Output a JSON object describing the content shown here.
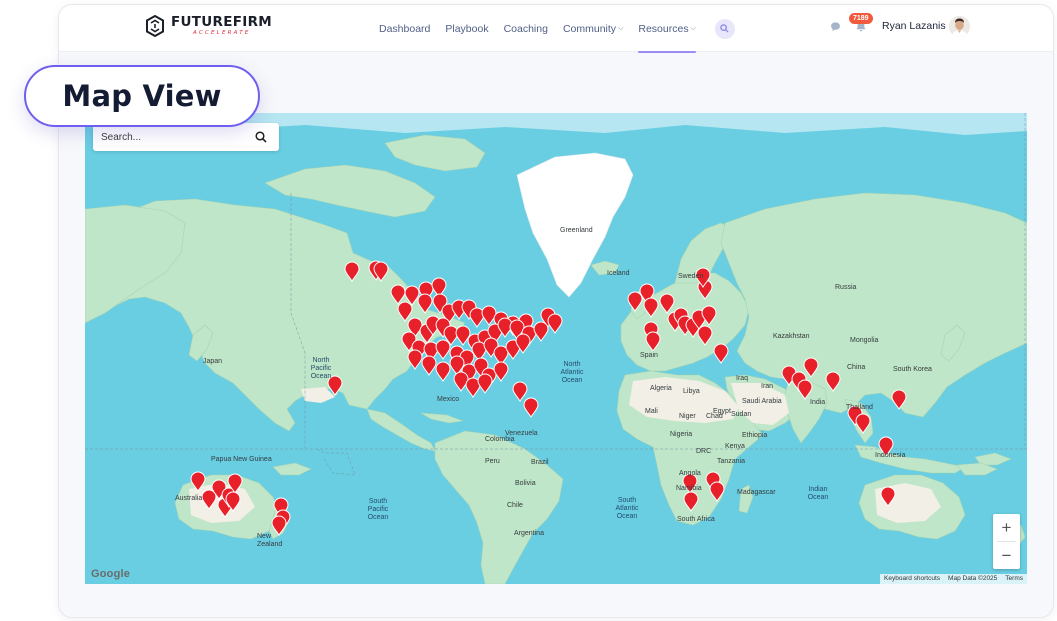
{
  "brand": {
    "name": "FUTUREFIRM",
    "tagline": "ACCELERATE"
  },
  "nav": [
    {
      "label": "Dashboard",
      "dropdown": false,
      "active": false
    },
    {
      "label": "Playbook",
      "dropdown": false,
      "active": false
    },
    {
      "label": "Coaching",
      "dropdown": false,
      "active": false
    },
    {
      "label": "Community",
      "dropdown": true,
      "active": false
    },
    {
      "label": "Resources",
      "dropdown": true,
      "active": true
    }
  ],
  "header": {
    "notification_count": "7189",
    "user_name": "Ryan Lazanis",
    "icons": [
      "search-icon",
      "chat-icon",
      "bell-icon",
      "avatar"
    ]
  },
  "callout": {
    "label": "Map View"
  },
  "map": {
    "search_placeholder": "Search...",
    "labels": {
      "greenland": "Greenland",
      "iceland": "Iceland",
      "sweden": "Sweden",
      "russia": "Russia",
      "kazakhstan": "Kazakhstan",
      "mongolia": "Mongolia",
      "china": "China",
      "south_korea": "South Korea",
      "japan": "Japan",
      "iran": "Iran",
      "iraq": "Iraq",
      "egypt": "Egypt",
      "libya": "Libya",
      "algeria": "Algeria",
      "mali": "Mali",
      "niger": "Niger",
      "chad": "Chad",
      "sudan": "Sudan",
      "nigeria": "Nigeria",
      "ethiopia": "Ethiopia",
      "kenya": "Kenya",
      "drc": "DRC",
      "tanzania": "Tanzania",
      "angola": "Angola",
      "namibia": "Namibia",
      "madagascar": "Madagascar",
      "south_africa": "South Africa",
      "saudi_arabia": "Saudi Arabia",
      "thailand": "Thailand",
      "india": "India",
      "indonesia": "Indonesia",
      "mexico": "Mexico",
      "venezuela": "Venezuela",
      "colombia": "Colombia",
      "peru": "Peru",
      "brazil": "Brazil",
      "bolivia": "Bolivia",
      "chile": "Chile",
      "argentina": "Argentina",
      "papua_new_guinea": "Papua New Guinea",
      "australia": "Australia",
      "new_zealand": "New Zealand",
      "spain": "Spain",
      "north_pacific_ocean": "North Pacific Ocean",
      "north_atlantic_ocean": "North Atlantic Ocean",
      "south_pacific_ocean": "South Pacific Ocean",
      "south_atlantic_ocean": "South Atlantic Ocean",
      "indian_ocean": "Indian Ocean"
    },
    "zoom_in": "+",
    "zoom_out": "−",
    "provider": "Google",
    "attribution": {
      "shortcuts": "Keyboard shortcuts",
      "data": "Map Data ©2025",
      "terms": "Terms"
    },
    "colors": {
      "water": "#69cee2",
      "land": "#bfe6c8",
      "land_desert": "#f1efe6",
      "ice": "#ffffff",
      "pin": "#e8202a"
    }
  }
}
